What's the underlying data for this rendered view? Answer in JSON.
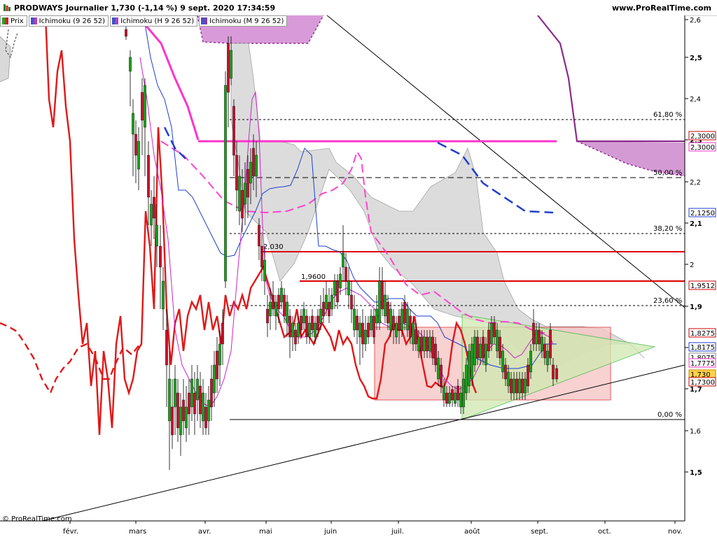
{
  "header": {
    "title": "PRODWAYS Journalier 1,730 (-1,14 %) 9 sept. 2020 17:34:59",
    "site": "www.ProRealTime.com"
  },
  "legend": [
    {
      "label": "Prix",
      "color": "#2e9e2e"
    },
    {
      "label": "Ichimoku (9 26 52)",
      "color": "#3a56c8"
    },
    {
      "label": "Ichimoku (H 9 26 52)",
      "color": "#b040c0"
    },
    {
      "label": "Ichimoku (M 9 26 52)",
      "color": "#7a3fb0"
    }
  ],
  "credit": "© ProRealTime.com",
  "chart_data": {
    "type": "candlestick",
    "y_axis": {
      "min": 1.4,
      "max": 2.6,
      "ticks": [
        1.5,
        1.6,
        1.7,
        1.8,
        1.9,
        2.0,
        2.1,
        2.2,
        2.3,
        2.4,
        2.5,
        2.6
      ],
      "tick_labels": [
        "1,5",
        "1,6",
        "1,7",
        "1,8",
        "1,9",
        "2",
        "2,1",
        "2,2",
        "2,3",
        "2,4",
        "2,5",
        "2,6"
      ]
    },
    "x_axis": {
      "labels": [
        "févr.",
        "mars",
        "avr.",
        "mai",
        "juin",
        "juil.",
        "août",
        "sept.",
        "oct.",
        "nov."
      ]
    },
    "fibonacci": [
      {
        "label": "61,80 %",
        "value": 2.347
      },
      {
        "label": "50,00 %",
        "value": 2.253
      },
      {
        "label": "38,20 %",
        "value": 2.147
      },
      {
        "label": "23,60 %",
        "value": 1.903
      },
      {
        "label": "0,00 %",
        "value": 1.63
      }
    ],
    "horizontal_lines": [
      {
        "label": "2,3000",
        "value": 2.3,
        "color": "#ff33cc"
      },
      {
        "label": "2,030",
        "value": 2.03,
        "color": "#dd0000"
      },
      {
        "label": "1,9600",
        "value": 1.96,
        "color": "#dd0000"
      }
    ],
    "price_tags": [
      {
        "text": "2,3000",
        "value": 2.3,
        "color": "#cc0000",
        "border": "#cc0000",
        "bg": "#ffffff"
      },
      {
        "text": "2,3000",
        "value": 2.2733,
        "color": "#ff33cc",
        "border": "#ff33cc",
        "bg": "#ffffff"
      },
      {
        "text": "2,1250",
        "value": 2.125,
        "color": "#1f3fd0",
        "border": "#1f3fd0",
        "bg": "#ffffff"
      },
      {
        "text": "1,9512",
        "value": 1.951,
        "color": "#cc0000",
        "border": "#cc0000",
        "bg": "#ffffff"
      },
      {
        "text": "1,8275",
        "value": 1.8275,
        "color": "#cc0000",
        "border": "#cc0000",
        "bg": "#ffffff"
      },
      {
        "text": "1,8175",
        "value": 1.8075,
        "color": "#1f3fd0",
        "border": "#1f3fd0",
        "bg": "#ffffff"
      },
      {
        "text": "1,8075",
        "value": 1.787,
        "color": "#888888",
        "border": "#888888",
        "bg": "#ffffff"
      },
      {
        "text": "1,7775",
        "value": 1.7775,
        "color": "#ff33cc",
        "border": "#ff33cc",
        "bg": "#ffffff"
      },
      {
        "text": "1,730",
        "value": 1.748,
        "color": "#000000",
        "border": "#c09000",
        "bg": "#ffd24d"
      },
      {
        "text": "1,7300",
        "value": 1.73,
        "color": "#cc0000",
        "border": "#cc0000",
        "bg": "#ffffff"
      }
    ],
    "series": [
      {
        "name": "Prix",
        "style": "candles"
      }
    ]
  }
}
